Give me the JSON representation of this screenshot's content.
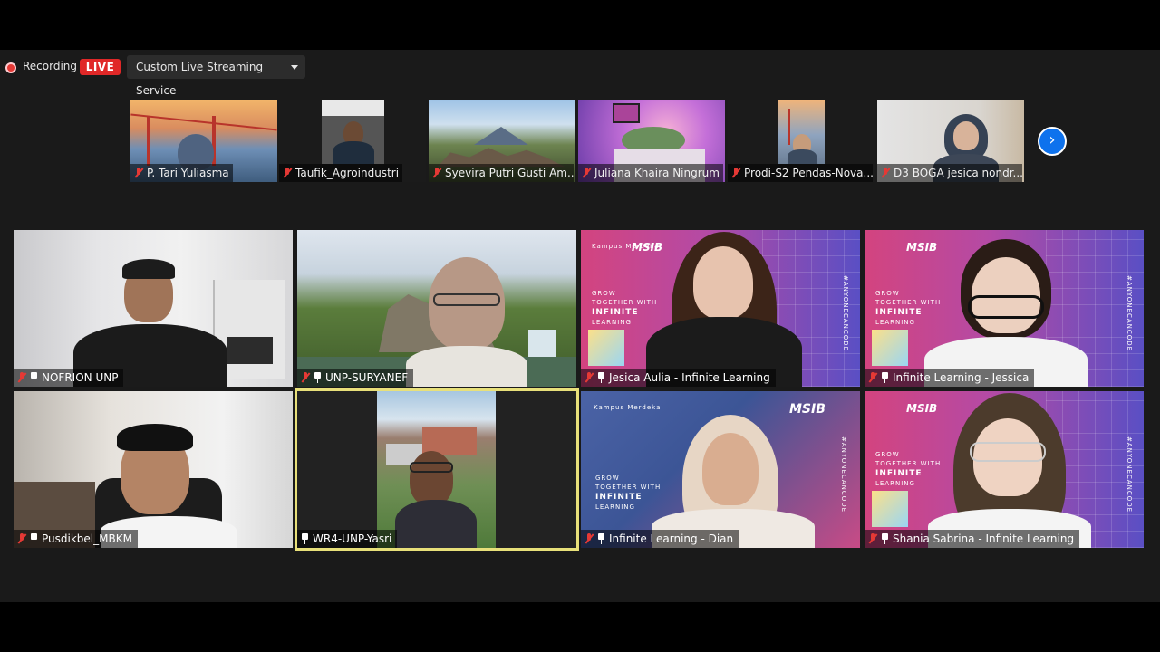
{
  "top_bar": {
    "recording_label": "Recording",
    "live_label": "LIVE",
    "stream_button_label": "Custom Live Streaming Service"
  },
  "strip": [
    {
      "name": "P. Tari Yuliasma"
    },
    {
      "name": "Taufik_Agroindustri"
    },
    {
      "name": "Syevira Putri Gusti Am..."
    },
    {
      "name": "Juliana Khaira Ningrum"
    },
    {
      "name": "Prodi-S2 Pendas-Nova..."
    },
    {
      "name": "D3 BOGA jesica nondr..."
    }
  ],
  "grid": [
    {
      "name": "NOFRION UNP"
    },
    {
      "name": "UNP-SURYANEF"
    },
    {
      "name": "Jesica Aulia - Infinite Learning"
    },
    {
      "name": "Infinite Learning - Jessica"
    },
    {
      "name": "Pusdikbel_MBKM"
    },
    {
      "name": "WR4-UNP-Yasri"
    },
    {
      "name": "Infinite Learning - Dian"
    },
    {
      "name": "Shania Sabrina - Infinite Learning"
    }
  ],
  "backdrop": {
    "brand": "MSIB",
    "campaign": "Kampus Merdeka",
    "tagline_1": "GROW",
    "tagline_2": "TOGETHER WITH",
    "tagline_3": "INFINITE",
    "tagline_4": "LEARNING",
    "hashtag": "#ANYONECANCODE"
  },
  "colors": {
    "live_red": "#e02828",
    "active_speaker": "#e8e07a",
    "next_button": "#0e72ed",
    "muted_mic": "#e53935"
  },
  "icons": [
    "record-icon",
    "caret-down-icon",
    "muted-mic-icon",
    "pin-icon",
    "chevron-right-icon"
  ]
}
